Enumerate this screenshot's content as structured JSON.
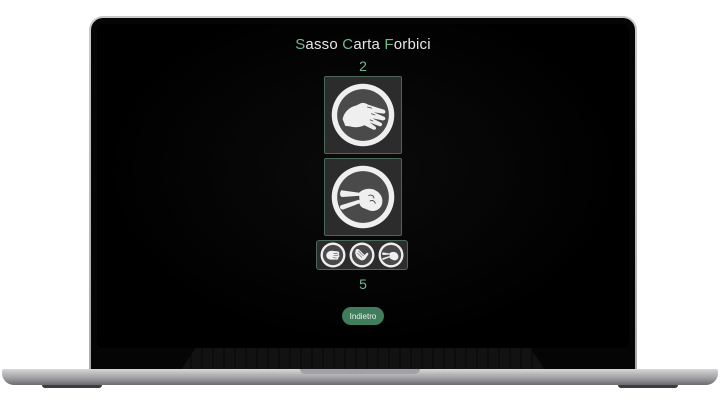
{
  "game": {
    "title_parts": [
      {
        "accent": "S",
        "rest": "asso"
      },
      {
        "accent": "C",
        "rest": "arta"
      },
      {
        "accent": "F",
        "rest": "orbici"
      }
    ],
    "opponent_score": "2",
    "player_score": "5",
    "opponent_choice_icon": "paper-hand-icon",
    "player_choice_icon": "scissors-hand-icon",
    "choices": [
      {
        "name": "rock",
        "icon": "rock-hand-icon"
      },
      {
        "name": "paper",
        "icon": "paper-hand-icon"
      },
      {
        "name": "scissors",
        "icon": "scissors-hand-icon"
      }
    ],
    "back_label": "Indietro"
  },
  "colors": {
    "accent": "#6fb98f",
    "button": "#3f7d5c",
    "card_bg": "#2c2c2c",
    "card_border": "#4b6757"
  }
}
